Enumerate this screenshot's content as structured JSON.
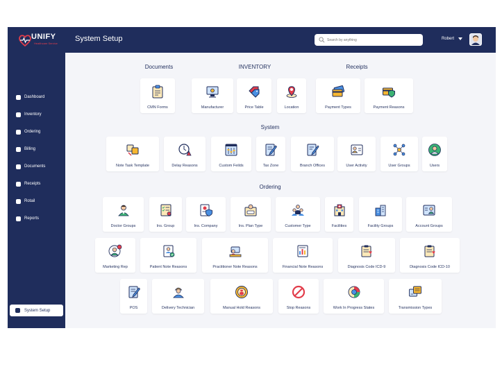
{
  "brand": {
    "name": "UNIFY",
    "tagline": "Healthcare Service"
  },
  "header": {
    "title": "System Setup",
    "search_placeholder": "Search by anything",
    "user_name": "Robert"
  },
  "sidebar": {
    "items": [
      "Dashboard",
      "Inventory",
      "Ordering",
      "Billing",
      "Documents",
      "Receipts",
      "Rotail",
      "Reports"
    ],
    "active": "System Setup"
  },
  "sections": {
    "documents": "Documents",
    "inventory": "INVENTORY",
    "receipts": "Receipts",
    "system": "System",
    "ordering": "Ordering"
  },
  "tiles": {
    "cmn_forms": "CMN Forms",
    "manufacturer": "Manufacturer",
    "price_table": "Price Table",
    "location": "Location",
    "payment_types": "Payment Types",
    "payment_reasons": "Payment Reasons",
    "note_task_template": "Note Task Template",
    "delay_reasons": "Delay Reasons",
    "custom_feilds": "Custom Feilds",
    "tax_zone": "Tax Zone",
    "branch_offices": "Branch Offices",
    "user_activity": "User Activity",
    "user_groups": "User Groups",
    "users": "Users",
    "doctor_groups": "Doctor Groups",
    "ins_group": "Ins. Group",
    "ins_company": "Ins. Company",
    "ins_plan_type": "Ins. Plan Type",
    "customer_type": "Customer Type",
    "facilities": "Facilities",
    "facility_groups": "Facility Groups",
    "account_groups": "Account Groups",
    "marketing_rep": "Marketing Rep",
    "patient_note_reasons": "Patient Note Reasons",
    "practitioner_note_reasons": "Practitioner Note Reasons",
    "financial_note_reasons": "Financial Note Reasons",
    "diagnosis_code_icd9": "Diagnosis Code ICD-9",
    "diagnosis_code_icd10": "Diagnosis Code ICD-10",
    "pos": "POS",
    "delivery_technician": "Delivery Technician",
    "manual_hold_reasons": "Manual Hold Reasons",
    "stop_reasons": "Stop Reasons",
    "work_in_progress_states": "Work In Progress States",
    "transmission_types": "Transmission Types"
  },
  "colors": {
    "navy": "#1f2d5c",
    "accent_red": "#e23d4b",
    "accent_yellow": "#f7b731",
    "accent_blue": "#4a90e2",
    "accent_green": "#3bb273"
  }
}
